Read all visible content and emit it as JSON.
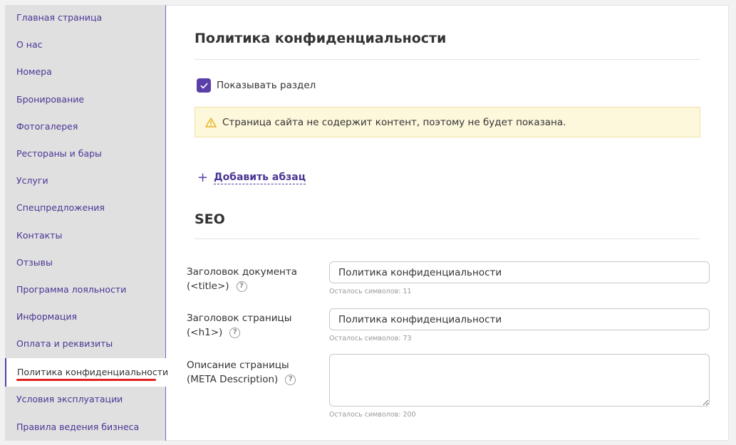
{
  "sidebar": {
    "items": [
      {
        "label": "Главная страница"
      },
      {
        "label": "О нас"
      },
      {
        "label": "Номера"
      },
      {
        "label": "Бронирование"
      },
      {
        "label": "Фотогалерея"
      },
      {
        "label": "Рестораны и бары"
      },
      {
        "label": "Услуги"
      },
      {
        "label": "Спецпредложения"
      },
      {
        "label": "Контакты"
      },
      {
        "label": "Отзывы"
      },
      {
        "label": "Программа лояльности"
      },
      {
        "label": "Информация"
      },
      {
        "label": "Оплата и реквизиты"
      },
      {
        "label": "Политика конфиденциальности"
      },
      {
        "label": "Условия эксплуатации"
      },
      {
        "label": "Правила ведения бизнеса"
      }
    ],
    "active_index": 13
  },
  "main": {
    "title": "Политика конфиденциальности",
    "show_section": {
      "label": "Показывать раздел",
      "checked": true
    },
    "warning": {
      "text": "Страница сайта не содержит контент, поэтому не будет показана."
    },
    "add_paragraph": {
      "label": "Добавить абзац"
    },
    "seo": {
      "title": "SEO",
      "doc_title": {
        "label_line1": "Заголовок документа",
        "label_line2": "(<title>)",
        "value": "Политика конфиденциальности",
        "hint": "Осталось символов: 11"
      },
      "page_title": {
        "label_line1": "Заголовок страницы",
        "label_line2": "(<h1>)",
        "value": "Политика конфиденциальности",
        "hint": "Осталось символов: 73"
      },
      "description": {
        "label_line1": "Описание страницы",
        "label_line2": "(META Description)",
        "value": "",
        "hint": "Осталось символов: 200"
      }
    }
  },
  "colors": {
    "accent": "#5b3fa8",
    "nav_text": "#4b3594",
    "warning_bg": "#fdf7dc",
    "highlight_underline": "#e02020"
  }
}
